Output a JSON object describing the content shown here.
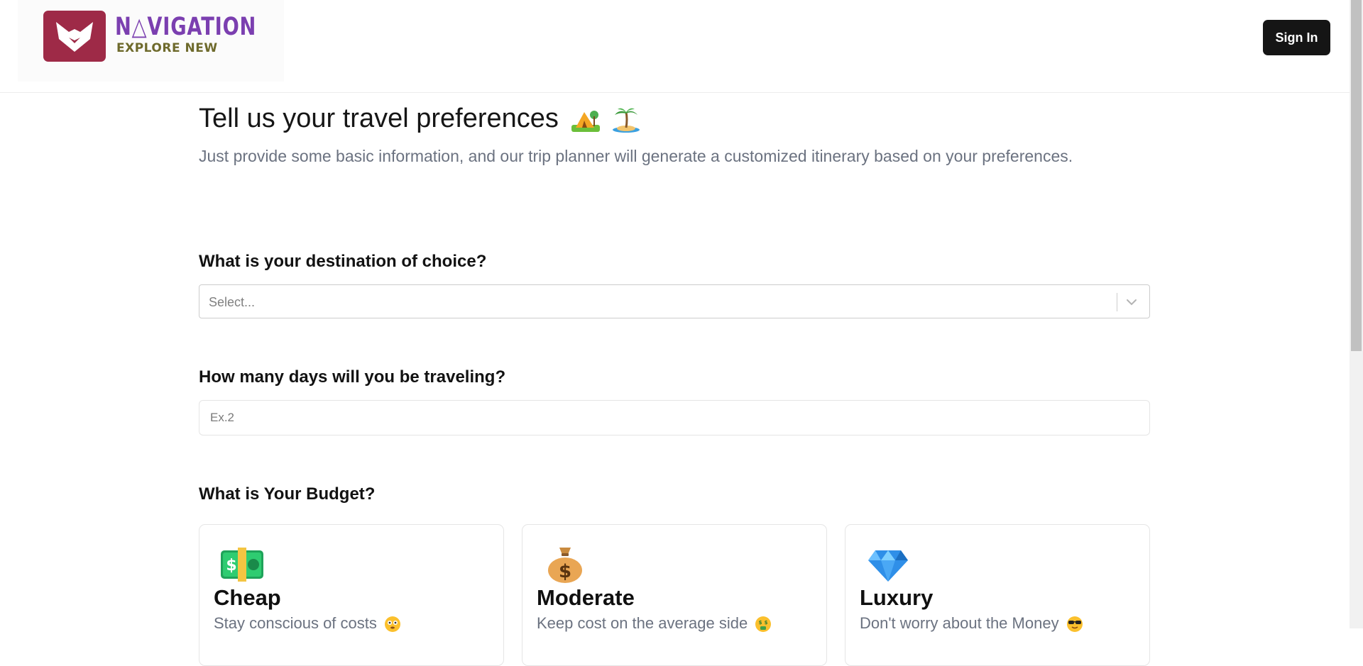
{
  "header": {
    "logo_title": "N△VIGATION",
    "logo_subtitle": "EXPLORE NEW",
    "sign_in_label": "Sign In"
  },
  "intro": {
    "title": "Tell us your travel preferences",
    "subtitle": "Just provide some basic information, and our trip planner will generate a customized itinerary based on your preferences."
  },
  "destination": {
    "label": "What is your destination of choice?",
    "placeholder": "Select..."
  },
  "days": {
    "label": "How many days will you be traveling?",
    "placeholder": "Ex.2"
  },
  "budget": {
    "label": "What is Your Budget?",
    "options": [
      {
        "icon": "dollar-bill-icon",
        "title": "Cheap",
        "desc": "Stay conscious of costs",
        "desc_emoji": "flushed-face-icon"
      },
      {
        "icon": "money-bag-icon",
        "title": "Moderate",
        "desc": "Keep cost on the average side",
        "desc_emoji": "money-mouth-face-icon"
      },
      {
        "icon": "gem-icon",
        "title": "Luxury",
        "desc": "Don't worry about the Money",
        "desc_emoji": "sunglasses-face-icon"
      }
    ]
  },
  "colors": {
    "brand_badge": "#9e2a47",
    "brand_title": "#7b3fb0",
    "brand_subtitle": "#6e6a2c",
    "button_bg": "#151515",
    "muted_text": "#6b7280"
  }
}
